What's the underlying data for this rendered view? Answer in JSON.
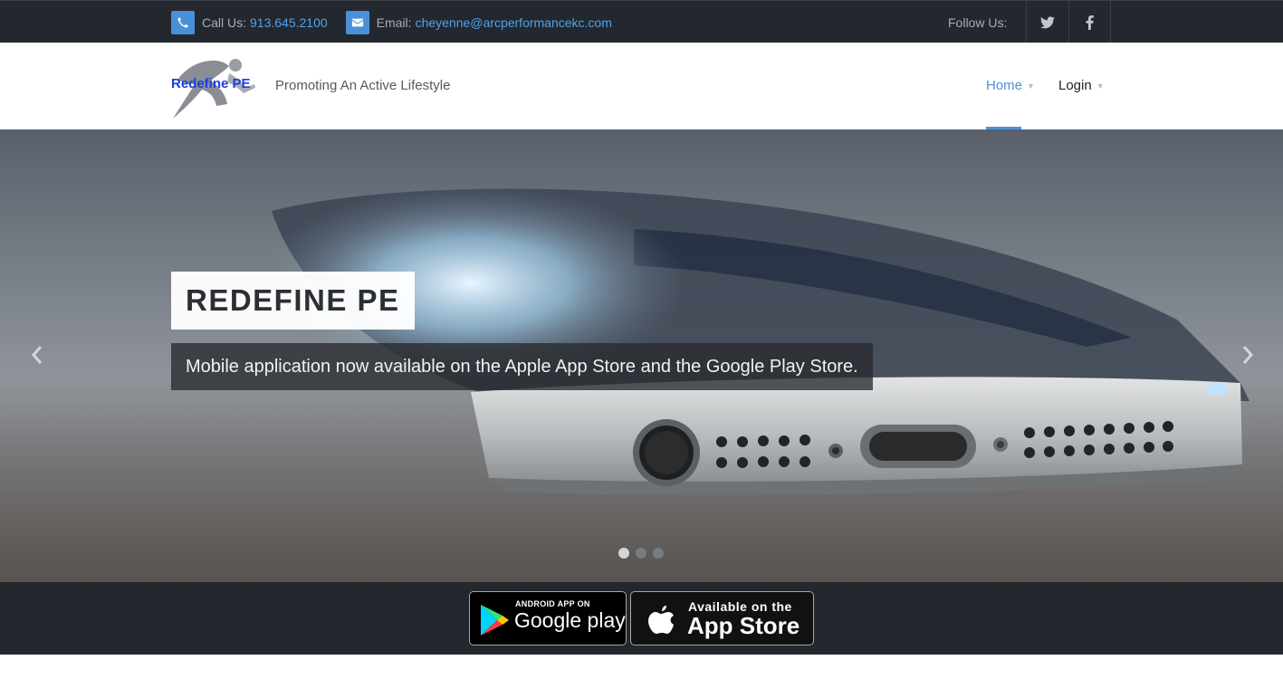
{
  "topbar": {
    "call_label": "Call Us:",
    "phone": "913.645.2100",
    "email_label": "Email:",
    "email": "cheyenne@arcperformancekc.com",
    "follow_label": "Follow Us:",
    "social_icons": [
      "twitter-icon",
      "facebook-icon"
    ]
  },
  "header": {
    "logo_text": "Redefine PE",
    "tagline": "Promoting An Active Lifestyle",
    "nav": [
      {
        "label": "Home",
        "active": true
      },
      {
        "label": "Login",
        "active": false
      }
    ]
  },
  "hero": {
    "title": "REDEFINE PE",
    "subtitle": "Mobile application now available on the Apple App Store and the Google Play Store.",
    "slide_count": 3,
    "active_slide": 1
  },
  "store_badges": {
    "google": {
      "small": "ANDROID APP ON",
      "big": "Google play"
    },
    "apple": {
      "small": "Available on the",
      "big": "App Store"
    }
  },
  "colors": {
    "accent": "#4a90d9",
    "topbar_bg": "#23272e",
    "logo_blue": "#1a3fe0"
  }
}
